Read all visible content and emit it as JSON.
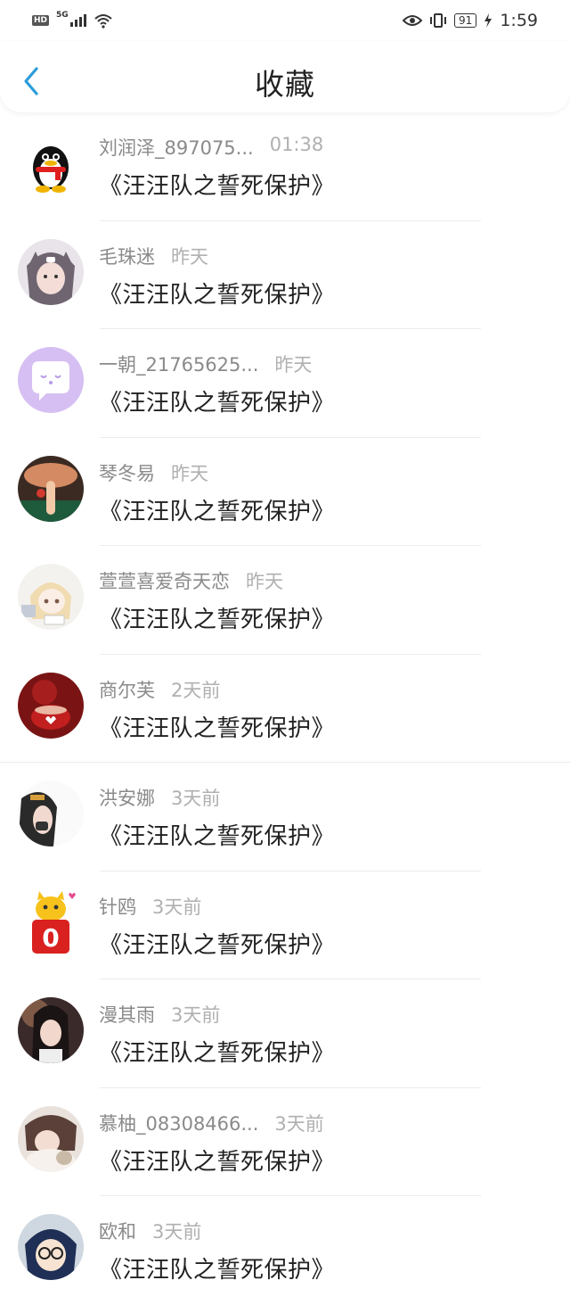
{
  "status": {
    "hd": "HD",
    "network": "5G",
    "battery": "91",
    "time": "1:59"
  },
  "header": {
    "title": "收藏"
  },
  "items": [
    {
      "name": "刘润泽_897075...",
      "time": "01:38",
      "message": "《汪汪队之誓死保护》"
    },
    {
      "name": "毛珠迷",
      "time": "昨天",
      "message": "《汪汪队之誓死保护》"
    },
    {
      "name": "一朝_21765625...",
      "time": "昨天",
      "message": "《汪汪队之誓死保护》"
    },
    {
      "name": "琴冬易",
      "time": "昨天",
      "message": "《汪汪队之誓死保护》"
    },
    {
      "name": "萱萱喜爱奇天恋",
      "time": "昨天",
      "message": "《汪汪队之誓死保护》"
    },
    {
      "name": "商尔芙",
      "time": "2天前",
      "message": "《汪汪队之誓死保护》"
    },
    {
      "name": "洪安娜",
      "time": "3天前",
      "message": "《汪汪队之誓死保护》"
    },
    {
      "name": "针鸥",
      "time": "3天前",
      "message": "《汪汪队之誓死保护》"
    },
    {
      "name": "漫其雨",
      "time": "3天前",
      "message": "《汪汪队之誓死保护》"
    },
    {
      "name": "慕柚_08308466...",
      "time": "3天前",
      "message": "《汪汪队之誓死保护》"
    },
    {
      "name": "欧和",
      "time": "3天前",
      "message": "《汪汪队之誓死保护》"
    }
  ],
  "colors": {
    "accent": "#2d9cdb",
    "name": "#8a8a8a",
    "time": "#b0b0b0"
  }
}
